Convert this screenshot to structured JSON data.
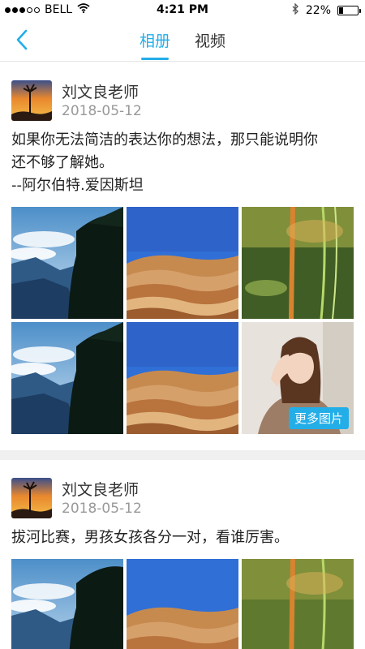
{
  "status": {
    "carrier": "BELL",
    "time": "4:21 PM",
    "battery": "22%",
    "battery_level": 0.22
  },
  "nav": {
    "back_icon": "chevron-left-icon",
    "tabs": [
      {
        "label": "相册",
        "active": true
      },
      {
        "label": "视频",
        "active": false
      }
    ]
  },
  "posts": [
    {
      "author": "刘文良老师",
      "date": "2018-05-12",
      "text_lines": [
        "如果你无法简洁的表达你的想法，那只能说明你",
        "还不够了解她。",
        "--阿尔伯特.爱因斯坦"
      ],
      "more_label": "更多图片"
    },
    {
      "author": "刘文良老师",
      "date": "2018-05-12",
      "text_lines": [
        "拔河比赛，男孩女孩各分一对，看谁厉害。"
      ]
    }
  ],
  "colors": {
    "accent": "#23aee8",
    "divider": "#f0f0f0"
  }
}
